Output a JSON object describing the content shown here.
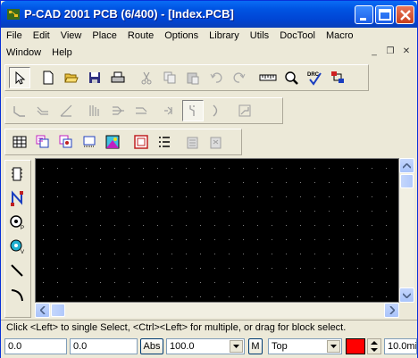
{
  "window": {
    "title": "P-CAD 2001 PCB (6/400) - [Index.PCB]"
  },
  "menu": {
    "row1": [
      "File",
      "Edit",
      "View",
      "Place",
      "Route",
      "Options",
      "Library",
      "Utils",
      "DocTool",
      "Macro"
    ],
    "row2": [
      "Window",
      "Help"
    ]
  },
  "mdi_controls": {
    "minimize": "_",
    "restore": "❐",
    "close": "✕"
  },
  "toolbar1": {
    "icons": [
      "select-arrow-icon",
      "new-file-icon",
      "open-folder-icon",
      "save-icon",
      "print-icon",
      "cut-icon",
      "copy-icon",
      "paste-icon",
      "undo-icon",
      "redo-icon",
      "measure-ruler-icon",
      "zoom-icon",
      "drc-icon",
      "netlist-icon"
    ],
    "drc_text": "DRC"
  },
  "toolbar2": {
    "icons": [
      "route-manual-icon",
      "route-multi-icon",
      "route-miter-icon",
      "route-bus-icon",
      "route-fanout-icon",
      "route-push-icon",
      "route-interactive-icon",
      "route-gloss-icon",
      "route-arc-icon",
      "route-diagonal-icon"
    ]
  },
  "toolbar3": {
    "icons": [
      "grid-table-icon",
      "layers-icon",
      "pads-icon",
      "via-icon",
      "image-icon",
      "board-outline-icon",
      "list-icon",
      "report-icon",
      "report2-icon"
    ]
  },
  "left_toolbar": {
    "icons": [
      "place-component-icon",
      "place-connection-icon",
      "place-pad-icon",
      "place-via-icon",
      "place-line-icon",
      "place-arc-icon"
    ]
  },
  "status": {
    "message": "Click <Left> to single Select, <Ctrl><Left> for multiple, or drag for block select."
  },
  "bottom": {
    "x_coord": "0.0",
    "y_coord": "0.0",
    "abs_label": "Abs",
    "grid_value": "100.0",
    "m_label": "M",
    "layer_value": "Top",
    "layer_color": "#ff0000",
    "line_width": "10.0mi"
  },
  "colors": {
    "canvas": "#000000",
    "grid_dot": "#808080",
    "title_bar": "#0054e3"
  }
}
